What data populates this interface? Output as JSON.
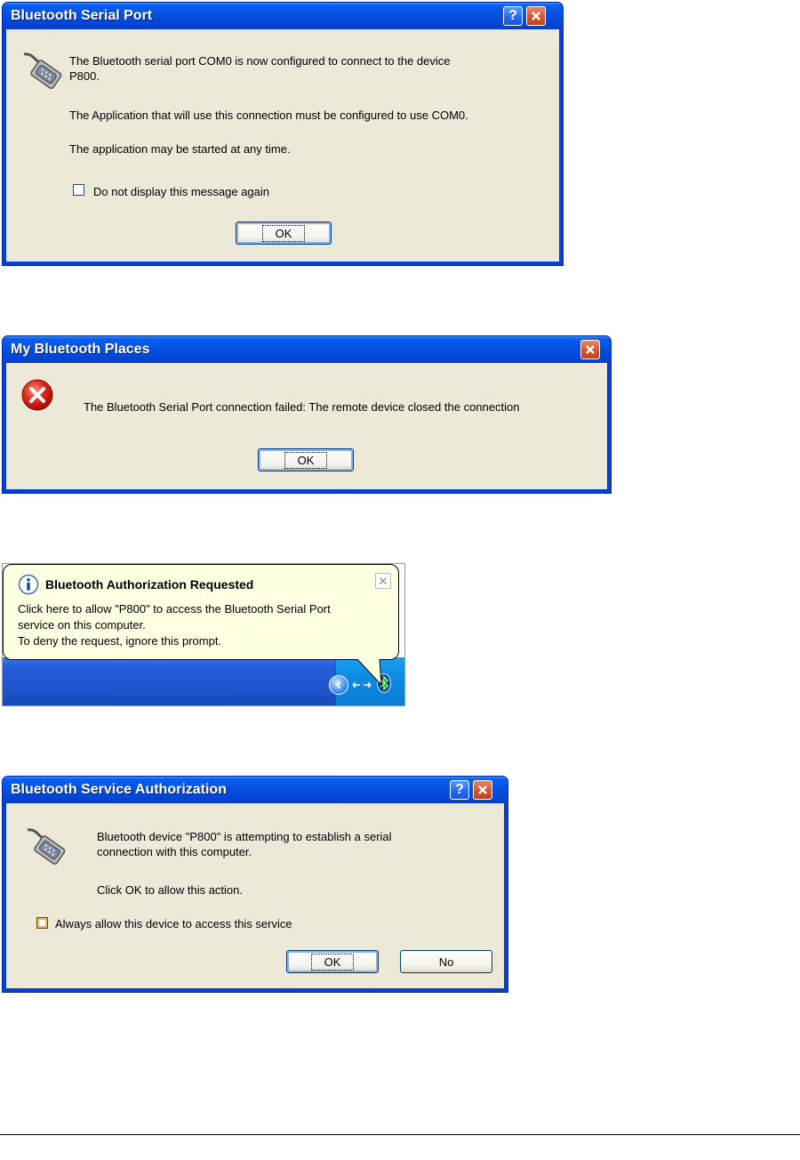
{
  "dialog_serial_port": {
    "title": "Bluetooth Serial Port",
    "line1": "The Bluetooth serial port COM0 is now configured to connect to the device",
    "line2": "P800.",
    "line3": "The Application that will use this connection must be configured to use COM0.",
    "line4": "The application may be started at any time.",
    "checkbox_label": "Do not display this message again",
    "ok_label": "OK"
  },
  "dialog_places": {
    "title": "My Bluetooth Places",
    "message": "The Bluetooth Serial Port connection failed:  The remote device closed the connection",
    "ok_label": "OK"
  },
  "balloon": {
    "title": "Bluetooth Authorization Requested",
    "line1": "Click here to allow \"P800\" to access the Bluetooth Serial Port",
    "line2": "service on this computer.",
    "line3": "To deny the request, ignore this prompt."
  },
  "dialog_authorization": {
    "title": "Bluetooth Service Authorization",
    "line1": "Bluetooth device \"P800\" is attempting to establish a serial",
    "line2": "connection with this computer.",
    "line3": "Click OK to allow this action.",
    "checkbox_label": "Always allow this device to access this service",
    "ok_label": "OK",
    "no_label": "No"
  },
  "icons": {
    "serial": "serial-port-icon",
    "error": "error-icon",
    "info": "info-icon",
    "bluetooth": "bluetooth-tray-icon"
  }
}
